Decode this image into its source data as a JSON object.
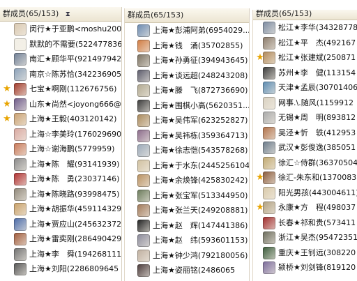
{
  "panels": [
    {
      "title": "群成员(65/153)",
      "members": [
        {
          "name": "闵行★于亚鹏<moshu200.",
          "star": false,
          "avatar": "#d9c8b0"
        },
        {
          "name": "默默的不需要(522477836",
          "star": false,
          "avatar": "#f2efe6"
        },
        {
          "name": "南汇★顾华平(921497942",
          "star": false,
          "avatar": "#6f7f96"
        },
        {
          "name": "南京☆陈苏恰(342236905",
          "star": false,
          "avatar": "#8aa0b8"
        },
        {
          "name": "七宝★啊刚(112676756)",
          "star": true,
          "avatar": "#a23a2a"
        },
        {
          "name": "山东★尚然<joyong666@.",
          "star": true,
          "avatar": "#6e5a8a"
        },
        {
          "name": "上海★王毅(403120142)",
          "star": true,
          "avatar": "#c9a070"
        },
        {
          "name": "上海☆李美玲(176029690",
          "star": false,
          "avatar": "#d8a8a0"
        },
        {
          "name": "上海☆谢海鹏(5779959)",
          "star": false,
          "avatar": "#c87858"
        },
        {
          "name": "上海★陈　耀(93141939)",
          "star": false,
          "avatar": "#8a8a8a"
        },
        {
          "name": "上海★陈　勇(23037146)",
          "star": false,
          "avatar": "#b03030"
        },
        {
          "name": "上海★陈晓路(93998475)",
          "star": false,
          "avatar": "#90887a"
        },
        {
          "name": "上海★胡振华(459114329",
          "star": false,
          "avatar": "#c8a068"
        },
        {
          "name": "上海★贾应山(245632372",
          "star": false,
          "avatar": "#4a6aa8"
        },
        {
          "name": "上海★雷奕刚(286490429",
          "star": false,
          "avatar": "#a05a3a"
        },
        {
          "name": "上海★李　舜(194268111",
          "star": false,
          "avatar": "#707070"
        },
        {
          "name": "上海★刘阳(2286809645",
          "star": false,
          "avatar": "#555555"
        }
      ]
    },
    {
      "title": "群成员(65/153)",
      "members": [
        {
          "name": "上海★彭浦阿弟(6954029...",
          "star": false,
          "avatar": "#6a8ab0"
        },
        {
          "name": "上海★钱　涌(35702855)",
          "star": false,
          "avatar": "#d07a40"
        },
        {
          "name": "上海★孙勇征(394943645)",
          "star": false,
          "avatar": "#7a7060"
        },
        {
          "name": "上海★谈远超(248243208)",
          "star": false,
          "avatar": "#5a5a6a"
        },
        {
          "name": "上海★滕　飞(872736690)",
          "star": false,
          "avatar": "#b0a890"
        },
        {
          "name": "上海★围棋小高(5620351...",
          "star": false,
          "avatar": "#3a3a3a"
        },
        {
          "name": "上海★吴伟军(623252827)",
          "star": false,
          "avatar": "#a8885a"
        },
        {
          "name": "上海★吴祎栋(359364713)",
          "star": false,
          "avatar": "#8a6a8a"
        },
        {
          "name": "上海★徐志恺(543578268)",
          "star": false,
          "avatar": "#9aa8b8"
        },
        {
          "name": "上海★于水东(2445256104)",
          "star": false,
          "avatar": "#d0c0a0"
        },
        {
          "name": "上海★余焕锋(425830242)",
          "star": false,
          "avatar": "#b89060"
        },
        {
          "name": "上海★张宝军(513344950)",
          "star": false,
          "avatar": "#6a7a5a"
        },
        {
          "name": "上海★张兰天(249208881)",
          "star": false,
          "avatar": "#a07858"
        },
        {
          "name": "上海★赵　辉(147441386)",
          "star": false,
          "avatar": "#202020"
        },
        {
          "name": "上海★赵　纬(593601153)",
          "star": false,
          "avatar": "#8a8a9a"
        },
        {
          "name": "上海★钟少鸿(792180056)",
          "star": false,
          "avatar": "#c0b0a0"
        },
        {
          "name": "上海★姿丽铭(2486065",
          "star": false,
          "avatar": "#4a3a3a"
        }
      ]
    },
    {
      "title": "群成员(65/153)",
      "members": [
        {
          "name": "松江★李华(34328778",
          "star": false,
          "avatar": "#7a8aa0"
        },
        {
          "name": "松江★平　杰(492167",
          "star": false,
          "avatar": "#8a7a6a"
        },
        {
          "name": "松江★张建斌(250871",
          "star": true,
          "avatar": "#b08858"
        },
        {
          "name": "苏州★李　健(113154",
          "star": false,
          "avatar": "#3a3a3a"
        },
        {
          "name": "天津★孟辰(30701406",
          "star": false,
          "avatar": "#5a8ab0"
        },
        {
          "name": "网事.\\.随风(1159912",
          "star": false,
          "avatar": "#d8d0c0"
        },
        {
          "name": "无锡★周　明(893812",
          "star": false,
          "avatar": "#a8a8a8"
        },
        {
          "name": "吴泾★忻　轶(412953",
          "star": false,
          "avatar": "#b07048"
        },
        {
          "name": "武汉★彭俊逸(385051",
          "star": false,
          "avatar": "#6a7a8a"
        },
        {
          "name": "徐汇☆侍群(36370504",
          "star": false,
          "avatar": "#c0a870"
        },
        {
          "name": "徐汇-朱东和(1370083",
          "star": true,
          "avatar": "#8a5a3a"
        },
        {
          "name": "阳光男孩(443004611)",
          "star": false,
          "avatar": "#d8c8a8"
        },
        {
          "name": "永康★方　程(498037",
          "star": true,
          "avatar": "#b0a080"
        },
        {
          "name": "长春★祁和贵(573411",
          "star": false,
          "avatar": "#a02a2a"
        },
        {
          "name": "浙江★吴杰(95472351",
          "star": false,
          "avatar": "#6a6a5a"
        },
        {
          "name": "重庆★王钊远(308220",
          "star": false,
          "avatar": "#3a5a3a"
        },
        {
          "name": "颍桥★刘剑锋(819120",
          "star": false,
          "avatar": "#7a6a9a"
        }
      ]
    }
  ]
}
